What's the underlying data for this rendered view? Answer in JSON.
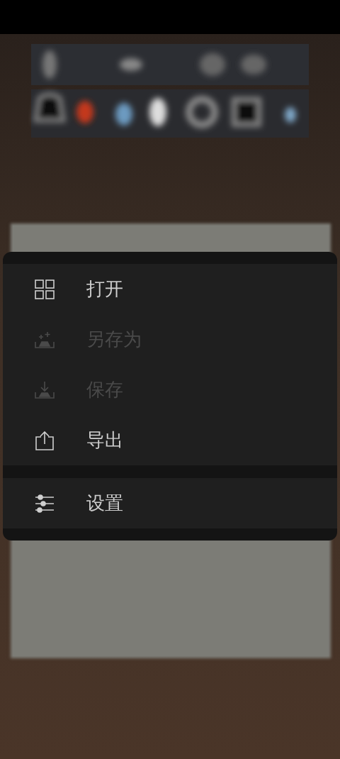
{
  "menu": {
    "groups": [
      {
        "items": [
          {
            "kind": "grid",
            "label": "打开",
            "disabled": false
          },
          {
            "kind": "saveas",
            "label": "另存为",
            "disabled": true
          },
          {
            "kind": "save",
            "label": "保存",
            "disabled": true
          },
          {
            "kind": "export",
            "label": "导出",
            "disabled": false
          }
        ]
      },
      {
        "items": [
          {
            "kind": "settings",
            "label": "设置",
            "disabled": false
          }
        ]
      }
    ]
  }
}
